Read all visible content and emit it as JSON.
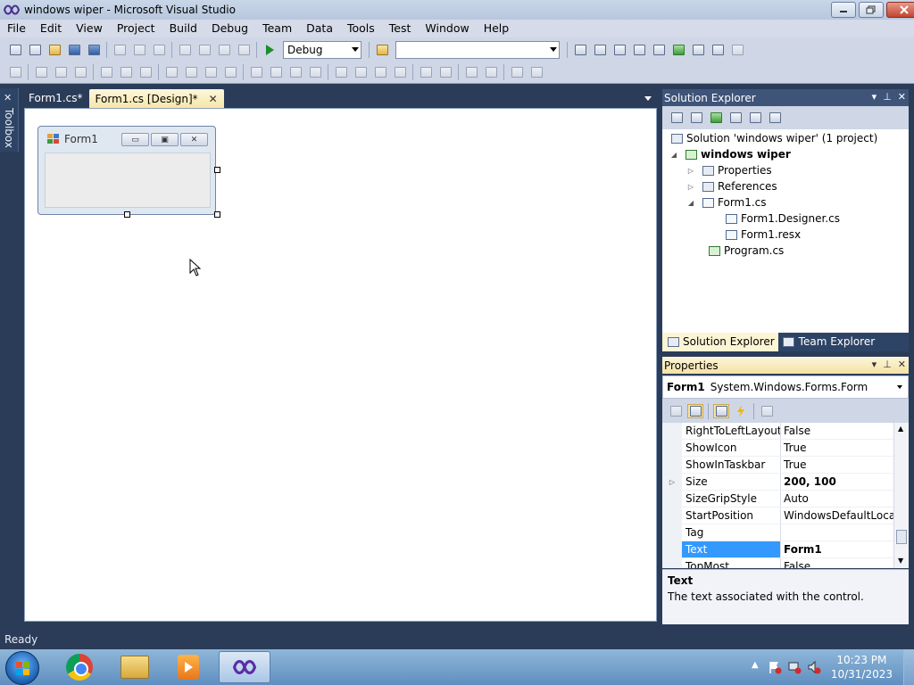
{
  "window": {
    "title": "windows wiper - Microsoft Visual Studio"
  },
  "menu": [
    "File",
    "Edit",
    "View",
    "Project",
    "Build",
    "Debug",
    "Team",
    "Data",
    "Tools",
    "Test",
    "Window",
    "Help"
  ],
  "toolbar": {
    "config_value": "Debug",
    "search_value": ""
  },
  "toolbox": {
    "label": "Toolbox"
  },
  "doc_tabs": [
    {
      "label": "Form1.cs*",
      "active": false
    },
    {
      "label": "Form1.cs [Design]*",
      "active": true
    }
  ],
  "designer": {
    "form_title": "Form1"
  },
  "status": {
    "text": "Ready"
  },
  "solution_explorer": {
    "title": "Solution Explorer",
    "items": [
      {
        "label": "Solution 'windows wiper' (1 project)",
        "bold": false
      },
      {
        "label": "windows wiper",
        "bold": true
      },
      {
        "label": "Properties"
      },
      {
        "label": "References"
      },
      {
        "label": "Form1.cs"
      },
      {
        "label": "Form1.Designer.cs"
      },
      {
        "label": "Form1.resx"
      },
      {
        "label": "Program.cs"
      }
    ],
    "tabs": [
      "Solution Explorer",
      "Team Explorer"
    ]
  },
  "properties": {
    "title": "Properties",
    "object_name": "Form1",
    "object_type": "System.Windows.Forms.Form",
    "rows": [
      {
        "name": "RightToLeftLayout",
        "value": "False"
      },
      {
        "name": "ShowIcon",
        "value": "True"
      },
      {
        "name": "ShowInTaskbar",
        "value": "True"
      },
      {
        "name": "Size",
        "value": "200, 100"
      },
      {
        "name": "SizeGripStyle",
        "value": "Auto"
      },
      {
        "name": "StartPosition",
        "value": "WindowsDefaultLocation"
      },
      {
        "name": "Tag",
        "value": ""
      },
      {
        "name": "Text",
        "value": "Form1"
      },
      {
        "name": "TopMost",
        "value": "False"
      }
    ],
    "description_title": "Text",
    "description": "The text associated with the control."
  },
  "taskbar": {
    "time": "10:23 PM",
    "date": "10/31/2023"
  }
}
